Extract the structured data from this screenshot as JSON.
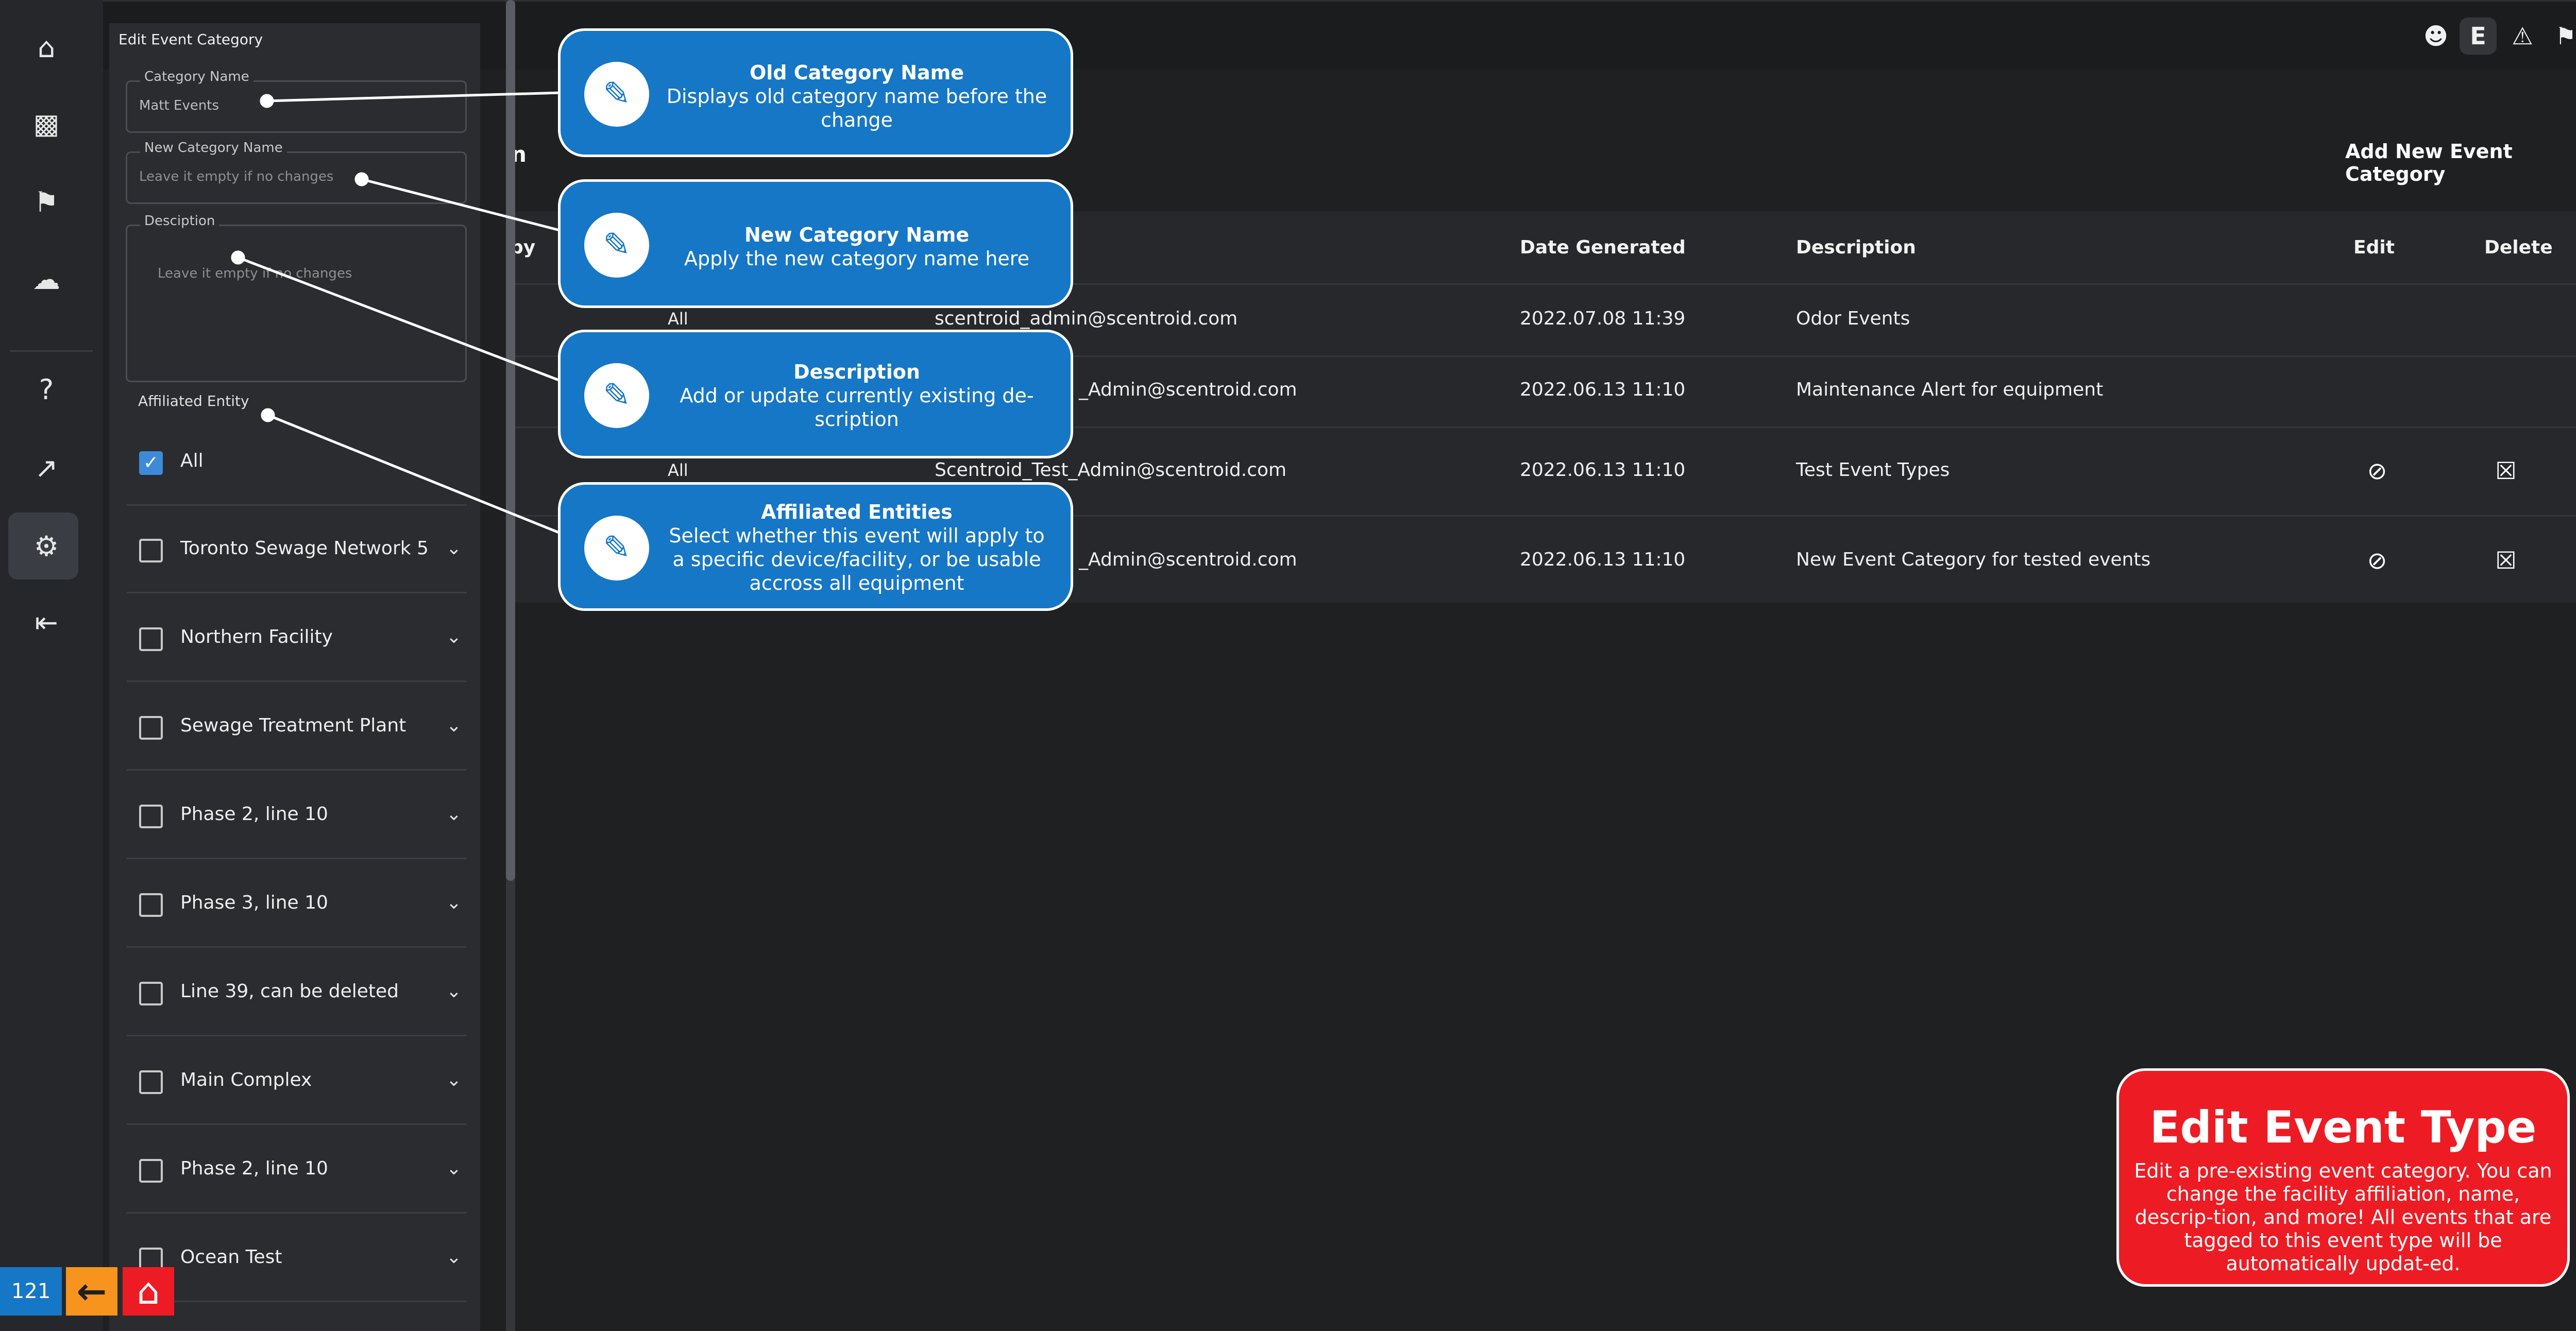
{
  "page_number": "121",
  "colors": {
    "callout": "#1677c6",
    "highlight_card": "#ed1c24",
    "nav_back": "#f7941d",
    "checkbox": "#3d8bd8"
  },
  "rail": {
    "icons": [
      "home-icon",
      "bar-chart-icon",
      "bell-icon",
      "weather-icon",
      "help-icon",
      "external-link-icon",
      "settings-icon",
      "logout-icon"
    ]
  },
  "topbar": {
    "icons": [
      "user-alert-icon",
      "e-badge-icon",
      "warning-icon",
      "bell-icon",
      "globe-icon"
    ],
    "e_label": "E"
  },
  "main": {
    "title_fragment": "n",
    "add_button": "Add New Event Category",
    "columns": {
      "by_fragment": "by",
      "date": "Date Generated",
      "description": "Description",
      "edit": "Edit",
      "delete": "Delete"
    },
    "rows": [
      {
        "entity": "All",
        "user": "scentroid_admin@scentroid.com",
        "date": "2022.07.08 11:39",
        "description": "Odor Events"
      },
      {
        "entity": "",
        "user": "_Admin@scentroid.com",
        "date": "2022.06.13 11:10",
        "description": "Maintenance Alert for equipment"
      },
      {
        "entity": "All",
        "user": "Scentroid_Test_Admin@scentroid.com",
        "date": "2022.06.13 11:10",
        "description": "Test Event Types"
      },
      {
        "entity": "",
        "user": "_Admin@scentroid.com",
        "date": "2022.06.13 11:10",
        "description": "New Event Category for tested events"
      }
    ]
  },
  "panel": {
    "title": "Edit Event Category",
    "category_name_label": "Category Name",
    "category_name_value": "Matt Events",
    "new_name_label": "New Category Name",
    "new_name_placeholder": "Leave it empty if no changes",
    "description_label": "Desciption",
    "description_placeholder": "Leave it empty if no changes",
    "entities_label": "Affiliated Entity",
    "entities": [
      {
        "label": "All",
        "checked": true
      },
      {
        "label": "Toronto Sewage Network 5",
        "checked": false
      },
      {
        "label": "Northern Facility",
        "checked": false
      },
      {
        "label": "Sewage Treatment Plant",
        "checked": false
      },
      {
        "label": "Phase 2, line 10",
        "checked": false
      },
      {
        "label": "Phase 3, line 10",
        "checked": false
      },
      {
        "label": "Line 39, can be deleted",
        "checked": false
      },
      {
        "label": "Main Complex",
        "checked": false
      },
      {
        "label": "Phase 2, line 10",
        "checked": false
      },
      {
        "label": "Ocean Test",
        "checked": false
      }
    ]
  },
  "callouts": [
    {
      "title": "Old Category Name",
      "body": "Displays old category name before the change"
    },
    {
      "title": "New Category Name",
      "body": "Apply the new category name here"
    },
    {
      "title": "Description",
      "body": "Add or update currently existing de-scription"
    },
    {
      "title": "Affiliated Entities",
      "body": "Select whether this event will apply to a specific device/facility, or be usable accross all equipment"
    }
  ],
  "highlight": {
    "title": "Edit Event Type",
    "body": "Edit a pre-existing event category. You can change the facility affiliation, name, descrip-tion, and more! All events that are tagged to this event type will be automatically updat-ed."
  }
}
